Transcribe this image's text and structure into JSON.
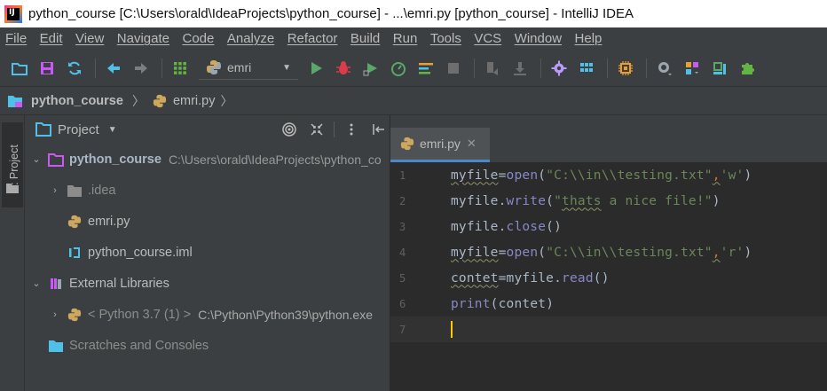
{
  "window": {
    "title": "python_course [C:\\Users\\orald\\IdeaProjects\\python_course] - ...\\emri.py [python_course] - IntelliJ IDEA",
    "logo_text": "IJ"
  },
  "menu": [
    "File",
    "Edit",
    "View",
    "Navigate",
    "Code",
    "Analyze",
    "Refactor",
    "Build",
    "Run",
    "Tools",
    "VCS",
    "Window",
    "Help"
  ],
  "toolbar": {
    "run_config": "emri"
  },
  "breadcrumb": {
    "project": "python_course",
    "file": "emri.py"
  },
  "toolstrip": {
    "project_tab": "1: Project"
  },
  "project_panel": {
    "title": "Project",
    "tree": {
      "root_name": "python_course",
      "root_path": "C:\\Users\\orald\\IdeaProjects\\python_co",
      "idea": ".idea",
      "file_py": "emri.py",
      "file_iml": "python_course.iml",
      "external_libraries": "External Libraries",
      "sdk": "< Python 3.7 (1) >",
      "sdk_path": "C:\\Python\\Python39\\python.exe",
      "scratches": "Scratches and Consoles"
    }
  },
  "editor": {
    "tab_label": "emri.py",
    "line_numbers": [
      "1",
      "2",
      "3",
      "4",
      "5",
      "6",
      "7"
    ],
    "code": {
      "l1_var": "myfile",
      "l1_eq": "=",
      "l1_fn": "open",
      "l1_open": "(",
      "l1_str1": "\"C:\\\\in\\\\testing.txt\"",
      "l1_comma": ",",
      "l1_str2": "'w'",
      "l1_close": ")",
      "l2_obj": "myfile.",
      "l2_method": "write",
      "l2_open": "(",
      "l2_str_a": "\"",
      "l2_str_b": "thats",
      "l2_str_c": " a nice file!\"",
      "l2_close": ")",
      "l3_obj": "myfile.",
      "l3_method": "close",
      "l3_parens": "()",
      "l4_var": "myfile",
      "l4_eq": "=",
      "l4_fn": "open",
      "l4_open": "(",
      "l4_str1": "\"C:\\\\in\\\\testing.txt\"",
      "l4_comma": ",",
      "l4_str2": "'r'",
      "l4_close": ")",
      "l5_var": "contet",
      "l5_eq": "=",
      "l5_obj": "myfile.",
      "l5_method": "read",
      "l5_parens": "()",
      "l6_fn": "print",
      "l6_open": "(",
      "l6_arg": "contet",
      "l6_close": ")"
    }
  },
  "colors": {
    "background": "#2b2b2b",
    "panel": "#3c3f41",
    "selection": "#0d293e",
    "string": "#6a8759",
    "builtin": "#8888c6",
    "cursor": "#ffc800"
  }
}
